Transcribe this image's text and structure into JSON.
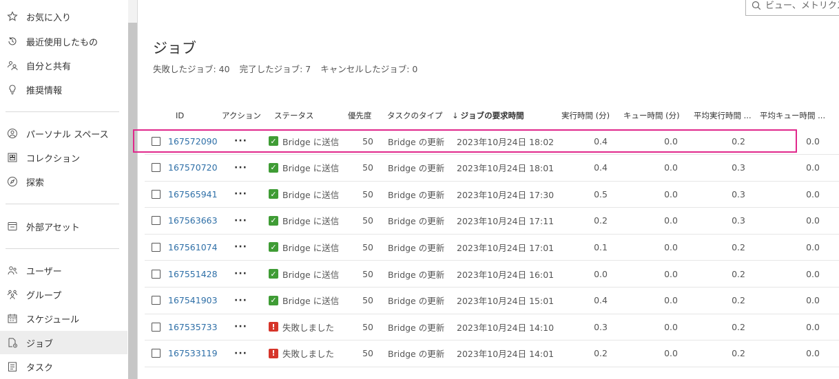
{
  "sidebar": {
    "items": [
      {
        "label": "お気に入り",
        "icon": "star-icon"
      },
      {
        "label": "最近使用したもの",
        "icon": "recent-icon"
      },
      {
        "label": "自分と共有",
        "icon": "shared-icon"
      },
      {
        "label": "推奨情報",
        "icon": "lightbulb-icon"
      },
      {
        "label": "パーソナル スペース",
        "icon": "personal-space-icon"
      },
      {
        "label": "コレクション",
        "icon": "collection-icon"
      },
      {
        "label": "探索",
        "icon": "explore-icon"
      },
      {
        "label": "外部アセット",
        "icon": "external-assets-icon"
      },
      {
        "label": "ユーザー",
        "icon": "user-icon"
      },
      {
        "label": "グループ",
        "icon": "group-icon"
      },
      {
        "label": "スケジュール",
        "icon": "calendar-icon"
      },
      {
        "label": "ジョブ",
        "icon": "jobs-icon"
      },
      {
        "label": "タスク",
        "icon": "tasks-icon"
      }
    ],
    "selected": "ジョブ"
  },
  "search": {
    "placeholder": "ビュー、メトリクス"
  },
  "page": {
    "title": "ジョブ"
  },
  "summary": {
    "failed": "失敗したジョブ: 40",
    "completed": "完了したジョブ: 7",
    "cancelled": "キャンセルしたジョブ: 0"
  },
  "table": {
    "headers": {
      "id": "ID",
      "action": "アクション",
      "status": "ステータス",
      "priority": "優先度",
      "task_type": "タスクのタイプ",
      "requested": "ジョブの要求時間",
      "sort_indicator": "↓",
      "run_time": "実行時間 (分)",
      "queue_time": "キュー時間 (分)",
      "avg_run": "平均実行時間 ...",
      "avg_queue": "平均キュー時間 ..."
    },
    "rows": [
      {
        "id": "167572090",
        "status": "Bridge に送信",
        "status_type": "success",
        "priority": "50",
        "task_type": "Bridge の更新",
        "requested": "2023年10月24日 18:02",
        "run_time": "0.4",
        "queue_time": "0.0",
        "avg_run": "0.2",
        "avg_queue": "0.0"
      },
      {
        "id": "167570720",
        "status": "Bridge に送信",
        "status_type": "success",
        "priority": "50",
        "task_type": "Bridge の更新",
        "requested": "2023年10月24日 18:01",
        "run_time": "0.4",
        "queue_time": "0.0",
        "avg_run": "0.3",
        "avg_queue": "0.0"
      },
      {
        "id": "167565941",
        "status": "Bridge に送信",
        "status_type": "success",
        "priority": "50",
        "task_type": "Bridge の更新",
        "requested": "2023年10月24日 17:30",
        "run_time": "0.5",
        "queue_time": "0.0",
        "avg_run": "0.3",
        "avg_queue": "0.0"
      },
      {
        "id": "167563663",
        "status": "Bridge に送信",
        "status_type": "success",
        "priority": "50",
        "task_type": "Bridge の更新",
        "requested": "2023年10月24日 17:11",
        "run_time": "0.2",
        "queue_time": "0.0",
        "avg_run": "0.3",
        "avg_queue": "0.0"
      },
      {
        "id": "167561074",
        "status": "Bridge に送信",
        "status_type": "success",
        "priority": "50",
        "task_type": "Bridge の更新",
        "requested": "2023年10月24日 17:01",
        "run_time": "0.1",
        "queue_time": "0.0",
        "avg_run": "0.2",
        "avg_queue": "0.0"
      },
      {
        "id": "167551428",
        "status": "Bridge に送信",
        "status_type": "success",
        "priority": "50",
        "task_type": "Bridge の更新",
        "requested": "2023年10月24日 16:01",
        "run_time": "0.0",
        "queue_time": "0.0",
        "avg_run": "0.2",
        "avg_queue": "0.0"
      },
      {
        "id": "167541903",
        "status": "Bridge に送信",
        "status_type": "success",
        "priority": "50",
        "task_type": "Bridge の更新",
        "requested": "2023年10月24日 15:01",
        "run_time": "0.4",
        "queue_time": "0.0",
        "avg_run": "0.2",
        "avg_queue": "0.0"
      },
      {
        "id": "167535733",
        "status": "失敗しました",
        "status_type": "error",
        "priority": "50",
        "task_type": "Bridge の更新",
        "requested": "2023年10月24日 14:10",
        "run_time": "0.3",
        "queue_time": "0.0",
        "avg_run": "0.2",
        "avg_queue": "0.0"
      },
      {
        "id": "167533119",
        "status": "失敗しました",
        "status_type": "error",
        "priority": "50",
        "task_type": "Bridge の更新",
        "requested": "2023年10月24日 14:01",
        "run_time": "0.2",
        "queue_time": "0.0",
        "avg_run": "0.2",
        "avg_queue": "0.0"
      }
    ]
  },
  "colors": {
    "link": "#2e6fa7",
    "success": "#3f9c35",
    "error": "#d6352a",
    "highlight": "#e0278b"
  }
}
